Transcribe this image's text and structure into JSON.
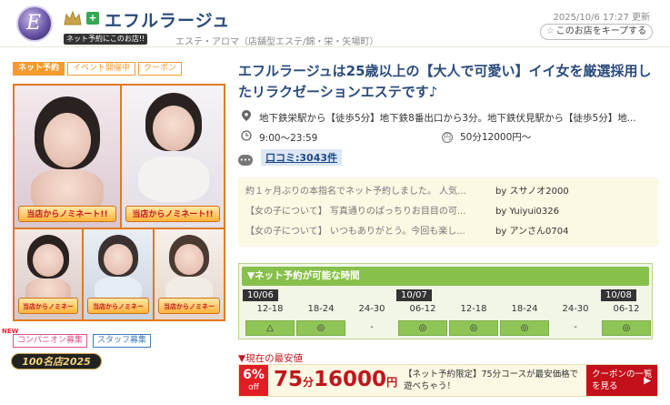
{
  "header": {
    "logo_letter": "E",
    "shop_name": "エフルラージュ",
    "net_badge": "ネット予約にこのお店!!",
    "category": "エステ・アロマ（店舗型エステ/錦・栄・矢場町）",
    "updated": "2025/10/6 17:27 更新",
    "keep_label": "このお店をキープする"
  },
  "tags": [
    "ネット予約",
    "イベント開催中",
    "クーポン"
  ],
  "photos": {
    "label": "当店からノミネート!!"
  },
  "recruit": {
    "new_label": "NEW",
    "companion": "コンパニオン募集",
    "staff": "スタッフ募集",
    "meiten": "100名店2025"
  },
  "catch_copy": "エフルラージュは25歳以上の【大人で可愛い】イイ女を厳選採用したリラクゼーションエステです♪",
  "info": {
    "access": "地下鉄栄駅から【徒歩5分】地下鉄8番出口から3分。地下鉄伏見駅から【徒歩5分】地...",
    "hours": "9:00〜23:59",
    "price": "50分12000円〜",
    "review_link": "口コミ:3043件",
    "yen_icon": "円"
  },
  "reviews": [
    {
      "text": "約１ヶ月ぶりの本指名でネット予約しました。 人気...",
      "by": "by スサノオ2000"
    },
    {
      "text": "【女の子について】 写真通りのぱっちりお目目の可...",
      "by": "by Yuiyui0326"
    },
    {
      "text": "【女の子について】 いつもありがとう。今回も楽し...",
      "by": "by アンさん0704"
    }
  ],
  "net_booking": {
    "title": "▼ネット予約が可能な時間",
    "dates": [
      "10/06",
      "10/07",
      "10/08"
    ],
    "slots": [
      "12-18",
      "18-24",
      "24-30",
      "06-12",
      "12-18",
      "18-24",
      "24-30",
      "06-12"
    ],
    "marks": [
      "△",
      "◎",
      "-",
      "◎",
      "◎",
      "◎",
      "-",
      "◎"
    ],
    "avail": [
      true,
      true,
      false,
      true,
      true,
      true,
      false,
      true
    ]
  },
  "lowest": {
    "label": "▼現在の最安値",
    "pct": "6%",
    "off": "off",
    "minutes": "75",
    "minutes_unit": "分",
    "price": "16000",
    "price_unit": "円",
    "desc": "【ネット予約限定】75分コースが最安価格で遊べちゃう！",
    "coupon_button": "クーポンの一覧を見る"
  },
  "colors": {
    "accent": "#f59a2e",
    "title_blue": "#2a4b7c",
    "booking_green": "#87c04a",
    "price_red": "#c0161d"
  }
}
